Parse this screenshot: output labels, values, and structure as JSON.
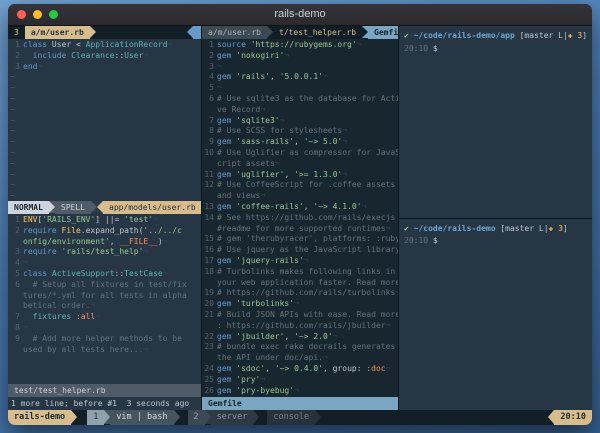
{
  "window": {
    "title": "rails-demo"
  },
  "colors": {
    "accent_tan": "#d7bd8d",
    "accent_blue": "#7aa6c2",
    "terminal_bg": "#263644",
    "terminal_bg_dark": "#18262f",
    "mode_fg": "#ced4de",
    "modified_red": "#ec5f67"
  },
  "left": {
    "tabline": [
      {
        "t": "3",
        "fg": "#d7bd8d",
        "dn": "tab-count",
        "di": "false"
      },
      {
        "t": "a/m/user.rb",
        "bg": "#d7bd8d",
        "fg": "#1f2d37",
        "bold": true,
        "arrow": true,
        "dn": "tab-user-rb",
        "di": "true"
      },
      {
        "spring": true
      },
      {
        "t": "",
        "bg": "#6699cc",
        "larrow": true,
        "w": 8,
        "dn": "tabline-right-cap",
        "di": "false"
      }
    ],
    "user_rb": {
      "rows": [
        {
          "n": "1",
          "s": [
            [
              "k",
              "class "
            ],
            [
              "o",
              "User"
            ],
            [
              "o",
              " < "
            ],
            [
              "t",
              "ApplicationRecord"
            ]
          ],
          "e": 1
        },
        {
          "n": "2",
          "s": [
            [
              "o",
              "  "
            ],
            [
              "k",
              "include "
            ],
            [
              "t",
              "Clearance"
            ],
            [
              "o",
              "::"
            ],
            [
              "t",
              "User"
            ]
          ],
          "e": 1
        },
        {
          "n": "3",
          "s": [
            [
              "k",
              "end"
            ]
          ],
          "e": 1
        }
      ],
      "tildes": 20
    },
    "statusline1": [
      {
        "t": "NORMAL",
        "bg": "#ced4de",
        "fg": "#1b2830",
        "bold": true,
        "arrow": true,
        "abg": "#4f5b66",
        "dn": "vim-mode-indicator",
        "di": "false"
      },
      {
        "t": "SPELL",
        "bg": "#4f5b66",
        "fg": "#ced4de",
        "arrow": true,
        "dn": "vim-spell-indicator",
        "di": "false"
      },
      {
        "spring": true
      },
      {
        "t": "app/models/user.rb",
        "bg": "#d7bd8d",
        "fg": "#1f2d37",
        "larrow": true,
        "dn": "vim-filename-active",
        "di": "false"
      },
      {
        "t": "",
        "bg": "#ec5f67",
        "larrow": true,
        "abg": "#d7bd8d",
        "w": 6,
        "dn": "vim-modified-flag",
        "di": "false"
      }
    ],
    "test_helper": {
      "rows": [
        {
          "n": "1",
          "s": [
            [
              "y",
              "ENV"
            ],
            [
              "o",
              "["
            ],
            [
              "s",
              "'RAILS_ENV'"
            ],
            [
              "o",
              "] ||= "
            ],
            [
              "s",
              "'test'"
            ]
          ],
          "e": 1
        },
        {
          "n": "2",
          "s": [
            [
              "k",
              "require "
            ],
            [
              "y",
              "File"
            ],
            [
              "o",
              ".expand_path("
            ],
            [
              "s",
              "'../../c"
            ]
          ]
        },
        {
          "n": "",
          "s": [
            [
              "s",
              "onfig/environment'"
            ],
            [
              "o",
              ", "
            ],
            [
              "r",
              "__FILE__"
            ],
            [
              "o",
              ")"
            ]
          ],
          "e": 1
        },
        {
          "n": "3",
          "s": [
            [
              "k",
              "require "
            ],
            [
              "s",
              "'rails/test_help'"
            ]
          ],
          "e": 1
        },
        {
          "n": "4",
          "s": [],
          "e": 1
        },
        {
          "n": "5",
          "s": [
            [
              "k",
              "class "
            ],
            [
              "t",
              "ActiveSupport"
            ],
            [
              "o",
              "::"
            ],
            [
              "t",
              "TestCase"
            ]
          ],
          "e": 1
        },
        {
          "n": "6",
          "s": [
            [
              "c",
              "  # Setup all fixtures in test/fix"
            ]
          ]
        },
        {
          "n": "",
          "s": [
            [
              "c",
              "tures/*.yml for all tests in alpha"
            ]
          ]
        },
        {
          "n": "",
          "s": [
            [
              "c",
              "betical order."
            ]
          ],
          "e": 1
        },
        {
          "n": "7",
          "s": [
            [
              "o",
              "  "
            ],
            [
              "t",
              "fixtures "
            ],
            [
              "r",
              ":all"
            ]
          ],
          "e": 1
        },
        {
          "n": "8",
          "s": [],
          "e": 1
        },
        {
          "n": "9",
          "s": [
            [
              "c",
              "  # Add more helper methods to be "
            ]
          ]
        },
        {
          "n": "",
          "s": [
            [
              "c",
              "used by all tests here..."
            ]
          ],
          "e": 1
        }
      ]
    },
    "statusline2": [
      {
        "t": "test/test_helper.rb",
        "bg": "#4f5b66",
        "fg": "#ccd3da",
        "grow": true,
        "dn": "vim-filename-inactive",
        "di": "false"
      }
    ],
    "message": "1 more line; before #1  3 seconds ago"
  },
  "mid": {
    "tabline": [
      {
        "t": "a/m/user.rb",
        "bg": "#3c4a54",
        "fg": "#aab4bc",
        "arrow": true,
        "abg": "#121e26",
        "dn": "buffer-tab-user-rb",
        "di": "true"
      },
      {
        "t": "t/test_helper.rb",
        "bg": "#121e26",
        "fg": "#d7bd8d",
        "arrow": true,
        "abg": "#7aa6c2",
        "dn": "buffer-tab-test-helper",
        "di": "true"
      },
      {
        "t": "Gemfile",
        "bg": "#7aa6c2",
        "fg": "#14222c",
        "bold": true,
        "arrow": true,
        "dn": "buffer-tab-gemfile",
        "di": "true"
      },
      {
        "spring": true
      }
    ],
    "gemfile": {
      "rows": [
        {
          "n": "1",
          "s": [
            [
              "k",
              "source "
            ],
            [
              "s",
              "'https://rubygems.org'"
            ]
          ],
          "e": 1
        },
        {
          "n": "2",
          "s": [
            [
              "k",
              "gem "
            ],
            [
              "s",
              "'nokogiri'"
            ]
          ],
          "e": 1
        },
        {
          "n": "3",
          "s": [],
          "e": 1
        },
        {
          "n": "4",
          "s": [
            [
              "k",
              "gem "
            ],
            [
              "s",
              "'rails'"
            ],
            [
              "o",
              ", "
            ],
            [
              "s",
              "'5.0.0.1'"
            ]
          ],
          "e": 1
        },
        {
          "n": "5",
          "s": [],
          "e": 1
        },
        {
          "n": "6",
          "s": [
            [
              "c",
              "# Use sqlite3 as the database for Acti"
            ]
          ]
        },
        {
          "n": "",
          "s": [
            [
              "c",
              "ve Record"
            ]
          ],
          "e": 1
        },
        {
          "n": "7",
          "s": [
            [
              "k",
              "gem "
            ],
            [
              "s",
              "'sqlite3'"
            ]
          ],
          "e": 1
        },
        {
          "n": "8",
          "s": [
            [
              "c",
              "# Use SCSS for stylesheets"
            ]
          ],
          "e": 1
        },
        {
          "n": "9",
          "s": [
            [
              "k",
              "gem "
            ],
            [
              "s",
              "'sass-rails'"
            ],
            [
              "o",
              ", "
            ],
            [
              "s",
              "'~> 5.0'"
            ]
          ],
          "e": 1
        },
        {
          "n": "10",
          "s": [
            [
              "c",
              "# Use Uglifier as compressor for JavaS"
            ]
          ]
        },
        {
          "n": "",
          "s": [
            [
              "c",
              "cript assets"
            ]
          ],
          "e": 1
        },
        {
          "n": "11",
          "s": [
            [
              "k",
              "gem "
            ],
            [
              "s",
              "'uglifier'"
            ],
            [
              "o",
              ", "
            ],
            [
              "s",
              "'>= 1.3.0'"
            ]
          ],
          "e": 1
        },
        {
          "n": "12",
          "s": [
            [
              "c",
              "# Use CoffeeScript for .coffee assets "
            ]
          ]
        },
        {
          "n": "",
          "s": [
            [
              "c",
              "and views"
            ]
          ],
          "e": 1
        },
        {
          "n": "13",
          "s": [
            [
              "k",
              "gem "
            ],
            [
              "s",
              "'coffee-rails'"
            ],
            [
              "o",
              ", "
            ],
            [
              "s",
              "'~> 4.1.0'"
            ]
          ],
          "e": 1
        },
        {
          "n": "14",
          "s": [
            [
              "c",
              "# See https://github.com/rails/execjs"
            ]
          ]
        },
        {
          "n": "",
          "s": [
            [
              "c",
              "#readme for more supported runtimes"
            ]
          ],
          "e": 1
        },
        {
          "n": "15",
          "s": [
            [
              "c",
              "# gem 'therubyracer', platforms: :ruby"
            ]
          ],
          "e": 1
        },
        {
          "n": "16",
          "s": [
            [
              "c",
              "# Use jquery as the JavaScript library"
            ]
          ],
          "e": 1
        },
        {
          "n": "17",
          "s": [
            [
              "k",
              "gem "
            ],
            [
              "s",
              "'jquery-rails'"
            ]
          ],
          "e": 1
        },
        {
          "n": "18",
          "s": [
            [
              "c",
              "# Turbolinks makes following links in "
            ]
          ]
        },
        {
          "n": "",
          "s": [
            [
              "c",
              "your web application faster. Read more"
            ]
          ],
          "e": 1
        },
        {
          "n": "19",
          "s": [
            [
              "c",
              "# https://github.com/rails/turbolinks"
            ]
          ],
          "e": 1
        },
        {
          "n": "20",
          "s": [
            [
              "k",
              "gem "
            ],
            [
              "s",
              "'turbolinks'"
            ]
          ],
          "e": 1
        },
        {
          "n": "21",
          "s": [
            [
              "c",
              "# Build JSON APIs with ease. Read more"
            ]
          ]
        },
        {
          "n": "",
          "s": [
            [
              "c",
              ": https://github.com/rails/jbuilder"
            ]
          ],
          "e": 1
        },
        {
          "n": "22",
          "s": [
            [
              "k",
              "gem "
            ],
            [
              "s",
              "'jbuilder'"
            ],
            [
              "o",
              ", "
            ],
            [
              "s",
              "'~> 2.0'"
            ]
          ],
          "e": 1
        },
        {
          "n": "23",
          "s": [
            [
              "c",
              "# bundle exec rake docrails generates "
            ]
          ]
        },
        {
          "n": "",
          "s": [
            [
              "c",
              "the API under doc/api."
            ]
          ],
          "e": 1
        },
        {
          "n": "24",
          "s": [
            [
              "k",
              "gem "
            ],
            [
              "s",
              "'sdoc'"
            ],
            [
              "o",
              ", "
            ],
            [
              "s",
              "'~> 0.4.0'"
            ],
            [
              "o",
              ", group: "
            ],
            [
              "r",
              ":doc"
            ]
          ],
          "e": 1
        },
        {
          "n": "25",
          "s": [
            [
              "k",
              "gem "
            ],
            [
              "s",
              "'pry'"
            ]
          ],
          "e": 1
        },
        {
          "n": "26",
          "s": [
            [
              "k",
              "gem "
            ],
            [
              "s",
              "'pry-byebug'"
            ]
          ],
          "e": 1
        }
      ]
    },
    "statusline": [
      {
        "t": "Gemfile",
        "bg": "#7aa6c2",
        "fg": "#14222c",
        "bold": true,
        "grow": true,
        "dn": "vim-statusline-gemfile-label",
        "di": "false"
      }
    ]
  },
  "right": {
    "top": {
      "rows": [
        {
          "s": [
            [
              "g",
              "✔ "
            ],
            [
              "path",
              "~/code/rails-demo/app"
            ],
            [
              "o",
              " [master L|"
            ],
            [
              "y",
              "✚ 3"
            ],
            [
              "o",
              "]"
            ]
          ]
        },
        {
          "s": [
            [
              "dim",
              "20:10"
            ],
            [
              "o",
              " $"
            ]
          ]
        }
      ]
    },
    "bottom": {
      "rows": [
        {
          "s": [
            [
              "g",
              "✔ "
            ],
            [
              "path",
              "~/code/rails-demo"
            ],
            [
              "o",
              " [master L|"
            ],
            [
              "y",
              "✚ 3"
            ],
            [
              "o",
              "]"
            ]
          ]
        },
        {
          "s": [
            [
              "dim",
              "20:10"
            ],
            [
              "o",
              " $"
            ]
          ]
        }
      ]
    }
  },
  "tmux": {
    "left": [
      {
        "t": "rails-demo",
        "bg": "#d7bd8d",
        "fg": "#1f2d37",
        "bold": true,
        "arrow": true,
        "dn": "tmux-session-name",
        "di": "true"
      },
      {
        "gap": 10
      },
      {
        "t": "1",
        "bg": "#90a1ac",
        "fg": "#1f2d37",
        "arrow": true,
        "abg": "#46545e",
        "dn": "tmux-window-1-index",
        "di": "true"
      },
      {
        "t": "vim | bash",
        "bg": "#46545e",
        "fg": "#d4dae0",
        "arrow": true,
        "dn": "tmux-window-1-name",
        "di": "true"
      },
      {
        "gap": 8
      },
      {
        "t": "2",
        "bg": "#3b4953",
        "fg": "#94a2ac",
        "arrow": true,
        "abg": "#2d3a44",
        "dn": "tmux-window-2-index",
        "di": "true"
      },
      {
        "t": "server",
        "bg": "#2d3a44",
        "fg": "#8795a0",
        "arrow": true,
        "dn": "tmux-window-2-name",
        "di": "true"
      },
      {
        "gap": 8
      },
      {
        "t": "console",
        "bg": "#27333c",
        "fg": "#77848e",
        "arrow": true,
        "dn": "tmux-window-3-name",
        "di": "true"
      }
    ],
    "right": [
      {
        "t": "20:10",
        "bg": "#d7bd8d",
        "fg": "#1f2d37",
        "bold": true,
        "larrow": true,
        "dn": "tmux-clock",
        "di": "false"
      }
    ]
  }
}
